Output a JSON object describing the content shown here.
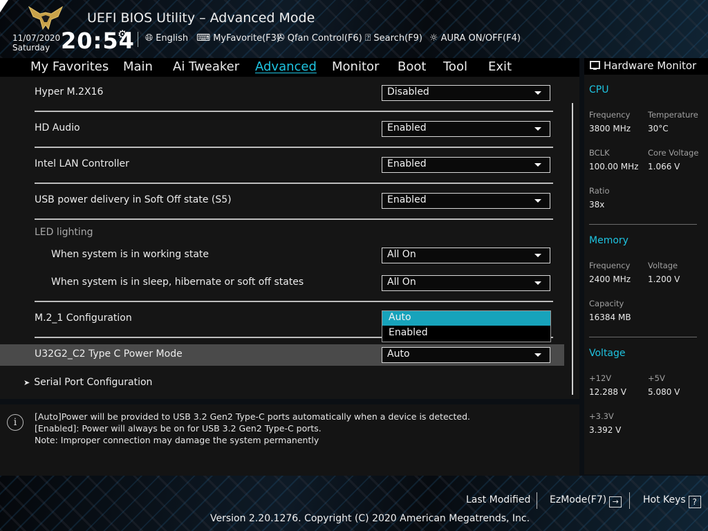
{
  "header": {
    "title": "UEFI BIOS Utility – Advanced Mode",
    "date": "11/07/2020",
    "day": "Saturday",
    "time": "20:54",
    "language": "English",
    "myfavorite": "MyFavorite(F3)",
    "qfan": "Qfan Control(F6)",
    "search": "Search(F9)",
    "aura": "AURA ON/OFF(F4)"
  },
  "menu": {
    "items": [
      "My Favorites",
      "Main",
      "Ai Tweaker",
      "Advanced",
      "Monitor",
      "Boot",
      "Tool",
      "Exit"
    ],
    "active": "Advanced"
  },
  "settings": {
    "hyper_m2": {
      "label": "Hyper M.2X16",
      "value": "Disabled"
    },
    "hd_audio": {
      "label": "HD Audio",
      "value": "Enabled"
    },
    "intel_lan": {
      "label": "Intel LAN Controller",
      "value": "Enabled"
    },
    "usb_power": {
      "label": "USB power delivery in Soft Off state (S5)",
      "value": "Enabled"
    },
    "led_section": "LED lighting",
    "led_working": {
      "label": "When system is in working state",
      "value": "All On"
    },
    "led_sleep": {
      "label": "When system is in sleep, hibernate or soft off states",
      "value": "All On"
    },
    "m2_config": {
      "label": "M.2_1 Configuration"
    },
    "u32g2": {
      "label": "U32G2_C2 Type C Power Mode",
      "value": "Auto"
    },
    "serial_port": {
      "label": "Serial Port Configuration"
    }
  },
  "popup": {
    "options": [
      "Auto",
      "Enabled"
    ],
    "selected": "Auto"
  },
  "help": {
    "line1": "[Auto]Power will be provided to USB 3.2 Gen2 Type-C ports automatically when a device is detected.",
    "line2": "[Enabled]: Power will always be on for USB 3.2 Gen2 Type-C ports.",
    "line3": "Note: Improper connection may damage the system permanently"
  },
  "hardware_monitor": {
    "title": "Hardware Monitor",
    "cpu": {
      "title": "CPU",
      "frequency_label": "Frequency",
      "frequency": "3800 MHz",
      "temperature_label": "Temperature",
      "temperature": "30°C",
      "bclk_label": "BCLK",
      "bclk": "100.00 MHz",
      "core_voltage_label": "Core Voltage",
      "core_voltage": "1.066 V",
      "ratio_label": "Ratio",
      "ratio": "38x"
    },
    "memory": {
      "title": "Memory",
      "frequency_label": "Frequency",
      "frequency": "2400 MHz",
      "voltage_label": "Voltage",
      "voltage": "1.200 V",
      "capacity_label": "Capacity",
      "capacity": "16384 MB"
    },
    "voltage": {
      "title": "Voltage",
      "v12_label": "+12V",
      "v12": "12.288 V",
      "v5_label": "+5V",
      "v5": "5.080 V",
      "v33_label": "+3.3V",
      "v33": "3.392 V"
    }
  },
  "footer": {
    "last_modified": "Last Modified",
    "ezmode": "EzMode(F7)",
    "hotkeys": "Hot Keys",
    "version": "Version 2.20.1276. Copyright (C) 2020 American Megatrends, Inc."
  },
  "colors": {
    "accent": "#1ec3e0",
    "popup_selected": "#17a3bb",
    "highlight_row": "#4a4a4a"
  }
}
